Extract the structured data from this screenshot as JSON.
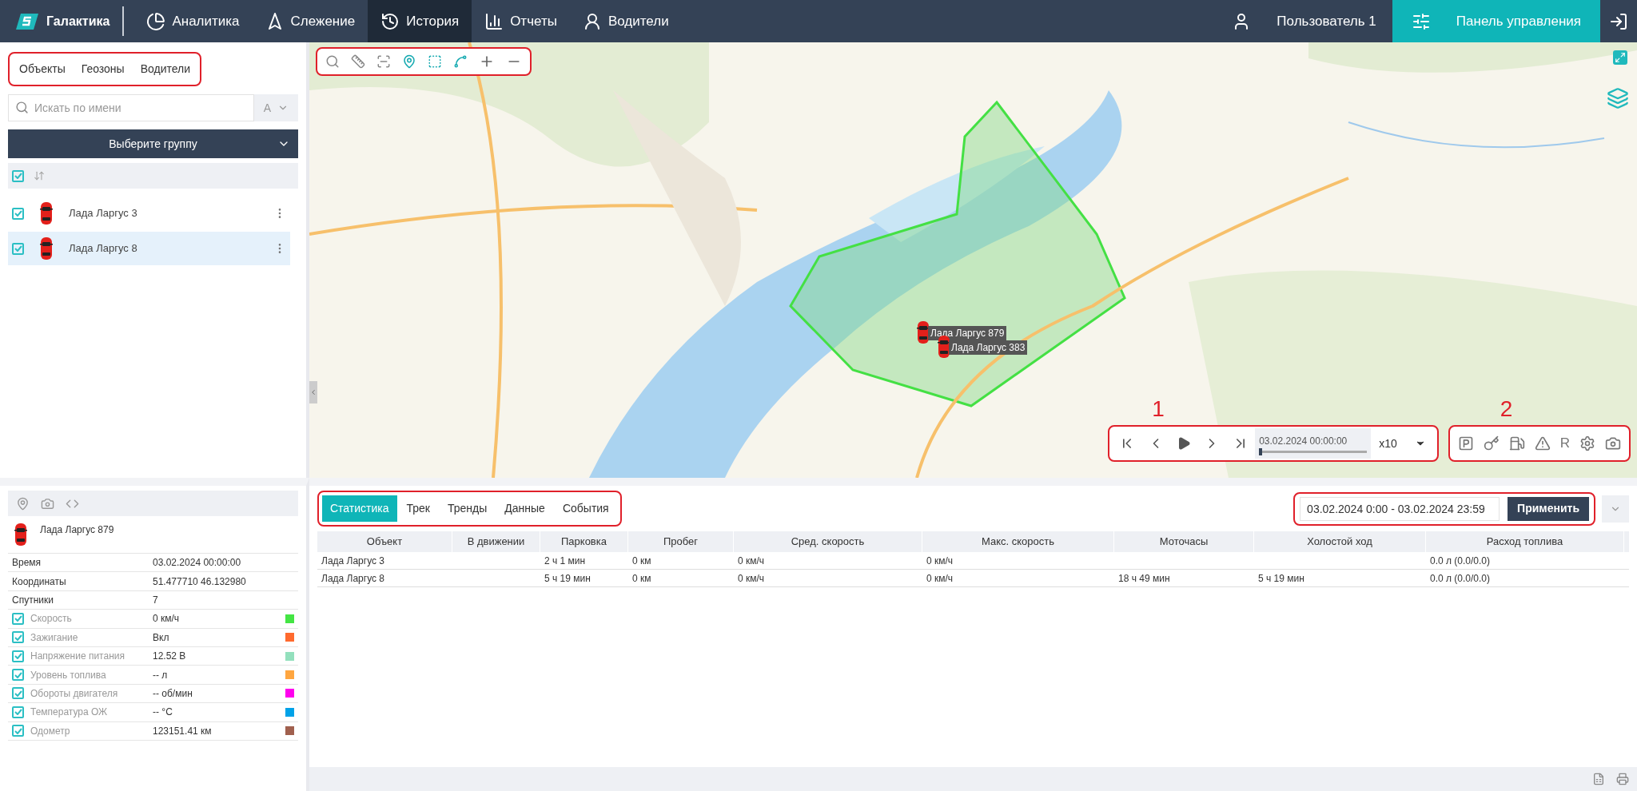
{
  "nav": {
    "brand": "Галактика",
    "items": [
      {
        "label": "Аналитика",
        "kind": "analytics",
        "selected": false
      },
      {
        "label": "Слежение",
        "kind": "tracking",
        "selected": false
      },
      {
        "label": "История",
        "kind": "history",
        "selected": true
      },
      {
        "label": "Отчеты",
        "kind": "reports",
        "selected": false
      },
      {
        "label": "Водители",
        "kind": "drivers",
        "selected": false
      }
    ],
    "user": "Пользователь 1",
    "control_panel": "Панель управления"
  },
  "sidebar": {
    "tabs": [
      "Объекты",
      "Геозоны",
      "Водители"
    ],
    "search": {
      "placeholder": "Искать по имени"
    },
    "sort_letter": "A",
    "group_select": "Выберите группу",
    "all_checked": true,
    "objects": [
      {
        "name": "Лада Ларгус 3",
        "checked": true,
        "selected": false
      },
      {
        "name": "Лада Ларгус 8",
        "checked": true,
        "selected": true
      }
    ]
  },
  "map": {
    "vehicles": [
      {
        "label": "Лада Ларгус 879"
      },
      {
        "label": "Лада Ларгус 383"
      }
    ],
    "playback": {
      "time": "03.02.2024 00:00:00",
      "level": 0.0,
      "speed": "x10"
    },
    "event_buttons": [
      {
        "kind": "parking"
      },
      {
        "kind": "key"
      },
      {
        "kind": "fuel"
      },
      {
        "kind": "warning"
      },
      {
        "kind": "letter",
        "label": "R"
      },
      {
        "kind": "settings"
      },
      {
        "kind": "camera"
      }
    ],
    "annotations": [
      "1",
      "2"
    ]
  },
  "info": {
    "title": "Лада Ларгус 879",
    "rows": [
      {
        "kind": "plain",
        "label": "Время",
        "value": "03.02.2024 00:00:00"
      },
      {
        "kind": "plain",
        "label": "Координаты",
        "value": "51.477710 46.132980"
      },
      {
        "kind": "plain",
        "label": "Спутники",
        "value": "7"
      },
      {
        "kind": "sensor",
        "label": "Скорость",
        "value": "0 км/ч",
        "checked": true,
        "color": "#44e544"
      },
      {
        "kind": "sensor",
        "label": "Зажигание",
        "value": "Вкл",
        "checked": true,
        "color": "#ff6a2e"
      },
      {
        "kind": "sensor",
        "label": "Напряжение питания",
        "value": "12.52 В",
        "checked": true,
        "color": "#93e0bd"
      },
      {
        "kind": "sensor",
        "label": "Уровень топлива",
        "value": "-- л",
        "checked": true,
        "color": "#ffa640"
      },
      {
        "kind": "sensor",
        "label": "Обороты двигателя",
        "value": "-- об/мин",
        "checked": true,
        "color": "#ff00ee"
      },
      {
        "kind": "sensor",
        "label": "Температура ОЖ",
        "value": "-- °C",
        "checked": true,
        "color": "#00a2e8"
      },
      {
        "kind": "sensor",
        "label": "Одометр",
        "value": "123151.41 км",
        "checked": true,
        "color": "#a0604e"
      }
    ]
  },
  "stats": {
    "tabs": [
      {
        "label": "Статистика",
        "selected": true
      },
      {
        "label": "Трек",
        "selected": false
      },
      {
        "label": "Тренды",
        "selected": false
      },
      {
        "label": "Данные",
        "selected": false
      },
      {
        "label": "События",
        "selected": false
      }
    ],
    "date_range": "03.02.2024 0:00 - 03.02.2024 23:59",
    "apply": "Применить",
    "table": {
      "columns": [
        "Объект",
        "В движении",
        "Парковка",
        "Пробег",
        "Сред. скорость",
        "Макс. скорость",
        "Моточасы",
        "Холостой ход",
        "Расход топлива"
      ],
      "rows": [
        [
          "Лада Ларгус 3",
          null,
          "2 ч 1 мин",
          "0 км",
          "0 км/ч",
          "0 км/ч",
          null,
          null,
          "0.0 л (0.0/0.0)"
        ],
        [
          "Лада Ларгус 8",
          null,
          "5 ч 19 мин",
          "0 км",
          "0 км/ч",
          "0 км/ч",
          "18 ч 49 мин",
          "5 ч 19 мин",
          "0.0 л (0.0/0.0)"
        ]
      ]
    }
  }
}
